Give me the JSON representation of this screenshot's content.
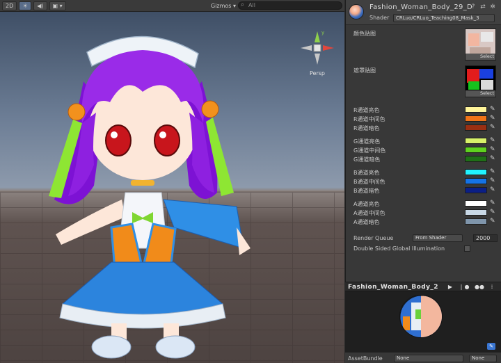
{
  "scene_toolbar": {
    "mode_2d": "2D",
    "lighting_icon": "sun-icon",
    "audio_icon": "speaker-icon",
    "effects_icon": "image-icon",
    "gizmos": "Gizmos ▾",
    "search_placeholder": "All"
  },
  "scene_gizmo": {
    "persp_label": "Persp",
    "axis_y": "y",
    "axis_x": "x",
    "axis_z": "z",
    "axis_colors": {
      "x": "#e2463d",
      "y": "#8fd14b",
      "z": "#3b7bdb"
    }
  },
  "inspector": {
    "material_name": "Fashion_Woman_Body_29_D",
    "shader_label": "Shader",
    "shader_value": "CRLuo/CRLuo_Teaching08_Mask_3",
    "textures": [
      {
        "label": "颜色贴图",
        "select": "Select"
      },
      {
        "label": "遮罩贴图",
        "select": "Select"
      }
    ],
    "color_groups": [
      {
        "rows": [
          {
            "label": "R通道亮色",
            "color": "#fff59a"
          },
          {
            "label": "R通道中间色",
            "color": "#f07418"
          },
          {
            "label": "R通道暗色",
            "color": "#9a2f12"
          }
        ]
      },
      {
        "rows": [
          {
            "label": "G通道亮色",
            "color": "#d8f26a"
          },
          {
            "label": "G通道中间色",
            "color": "#5fd21f"
          },
          {
            "label": "G通道暗色",
            "color": "#1f6f17"
          }
        ]
      },
      {
        "rows": [
          {
            "label": "B通道亮色",
            "color": "#21f2ff"
          },
          {
            "label": "B通道中间色",
            "color": "#1573e6"
          },
          {
            "label": "B通道暗色",
            "color": "#0b1f86"
          }
        ]
      },
      {
        "rows": [
          {
            "label": "A通道亮色",
            "color": "#ffffff"
          },
          {
            "label": "A通道中间色",
            "color": "#c8d8e6"
          },
          {
            "label": "A通道暗色",
            "color": "#7f95ab"
          }
        ]
      }
    ],
    "render_queue_label": "Render Queue",
    "render_queue_mode": "From Shader",
    "render_queue_value": "2000",
    "dsgi_label": "Double Sided Global Illumination"
  },
  "preview": {
    "name": "Fashion_Woman_Body_2"
  },
  "assetbundle": {
    "label": "AssetBundle",
    "name_value": "None",
    "variant_value": "None"
  }
}
